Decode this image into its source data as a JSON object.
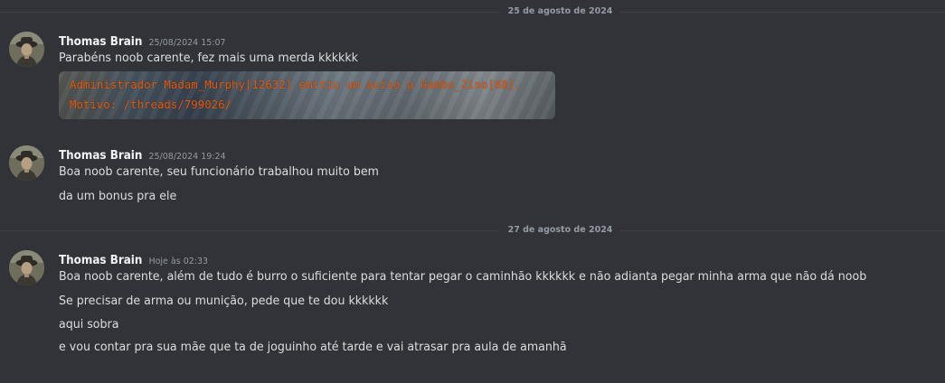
{
  "dividers": [
    {
      "label": "25 de agosto de 2024"
    },
    {
      "label": "27 de agosto de 2024"
    }
  ],
  "messages": [
    {
      "username": "Thomas Brain",
      "timestamp": "25/08/2024 15:07",
      "lines": [
        "Parabéns noob carente, fez mais uma merda kkkkkk"
      ],
      "attachment": {
        "lines": [
          "Administrador Madam_Murphy[12632] emitiu um aviso a Gambo_Zino[68].",
          "Motivo: /threads/799026/"
        ],
        "text_color": "#e8590c"
      }
    },
    {
      "username": "Thomas Brain",
      "timestamp": "25/08/2024 19:24",
      "lines": [
        "Boa noob carente, seu funcionário trabalhou muito bem",
        "da um bonus pra ele"
      ]
    },
    {
      "username": "Thomas Brain",
      "timestamp": "Hoje às 02:33",
      "lines": [
        "Boa noob carente, além de tudo é burro o suficiente para tentar pegar o caminhão kkkkkk e não adianta pegar minha arma que não dá noob",
        "Se precisar de arma ou munição, pede que te dou kkkkkk",
        "aqui sobra",
        "e vou contar pra sua mãe que ta de joguinho até tarde e vai atrasar pra aula de amanhã"
      ]
    }
  ],
  "colors": {
    "background": "#313338",
    "username": "#f2f3f5",
    "text": "#dbdee1",
    "muted": "#949ba4",
    "divider_line": "#3f4147"
  }
}
